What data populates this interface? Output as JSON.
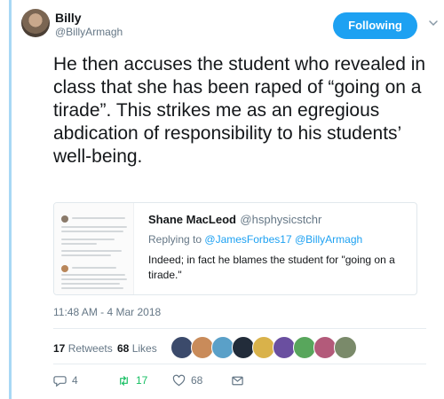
{
  "author": {
    "name": "Billy",
    "handle": "@BillyArmagh"
  },
  "follow_button": "Following",
  "tweet_text": "He then accuses the student who revealed in class that she has been raped of “going on a tirade”. This strikes me as an egregious abdication of responsibility to his students’ well-being.",
  "quoted": {
    "name": "Shane MacLeod",
    "handle": "@hsphysicstchr",
    "reply_prefix": "Replying to",
    "reply_to_1": "@JamesForbes17",
    "reply_to_2": "@BillyArmagh",
    "text": "Indeed; in fact he blames the student for \"going on a tirade.\""
  },
  "timestamp": "11:48 AM - 4 Mar 2018",
  "stats": {
    "retweets_count": "17",
    "retweets_label": "Retweets",
    "likes_count": "68",
    "likes_label": "Likes"
  },
  "liker_colors": [
    "#3b4a6b",
    "#c98b5a",
    "#5aa0c8",
    "#222c3a",
    "#d9b24a",
    "#6a4fa0",
    "#58a65c",
    "#b35a7a",
    "#7a8a6a"
  ],
  "actions": {
    "reply_count": "4",
    "retweet_count": "17",
    "like_count": "68"
  },
  "colors": {
    "accent": "#1da1f2",
    "retweet": "#17bf63",
    "muted": "#657786"
  },
  "icons": [
    "chevron-down-icon",
    "reply-icon",
    "retweet-icon",
    "heart-icon",
    "message-icon"
  ]
}
